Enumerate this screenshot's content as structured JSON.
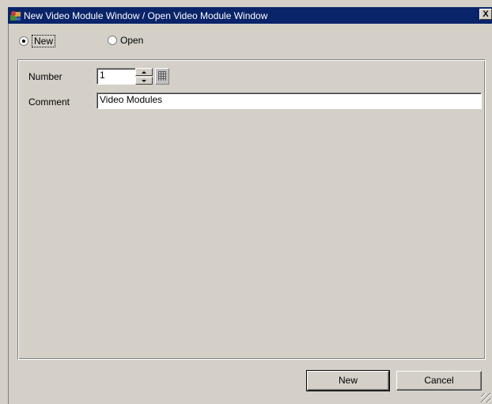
{
  "window": {
    "title": "New Video Module Window / Open Video Module Window",
    "close_label": "X"
  },
  "mode": {
    "new_label": "New",
    "open_label": "Open",
    "selected": "New"
  },
  "form": {
    "number_label": "Number",
    "number_value": "1",
    "comment_label": "Comment",
    "comment_value": "Video Modules"
  },
  "buttons": {
    "new_label": "New",
    "cancel_label": "Cancel"
  },
  "colors": {
    "titlebar": "#0a246a",
    "face": "#d4d0c8"
  }
}
